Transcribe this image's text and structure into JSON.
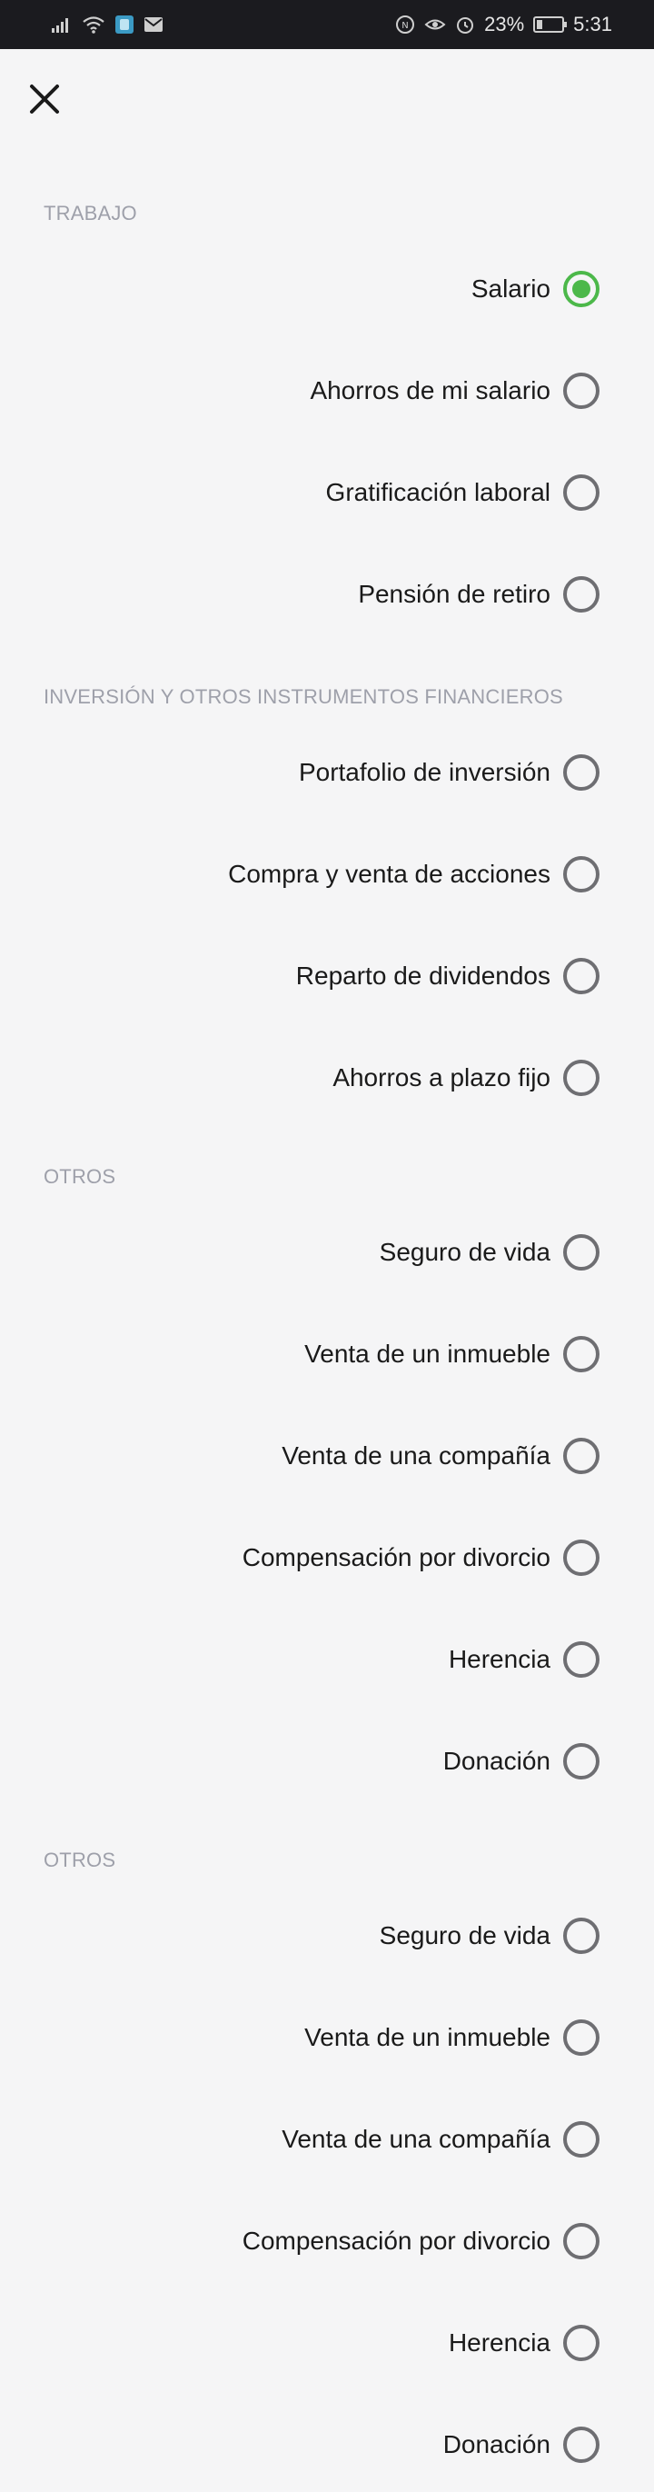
{
  "status_bar": {
    "battery_percent": "23%",
    "time": "5:31",
    "battery_level": 0.23
  },
  "close_icon": "close-icon",
  "sections": [
    {
      "title": "TRABAJO",
      "options": [
        {
          "label": "Salario",
          "selected": true
        },
        {
          "label": "Ahorros de mi salario",
          "selected": false
        },
        {
          "label": "Gratificación laboral",
          "selected": false
        },
        {
          "label": "Pensión de retiro",
          "selected": false
        }
      ]
    },
    {
      "title": "INVERSIÓN Y OTROS INSTRUMENTOS FINANCIEROS",
      "options": [
        {
          "label": "Portafolio de inversión",
          "selected": false
        },
        {
          "label": "Compra y venta de acciones",
          "selected": false
        },
        {
          "label": "Reparto de dividendos",
          "selected": false
        },
        {
          "label": "Ahorros a plazo fijo",
          "selected": false
        }
      ]
    },
    {
      "title": "OTROS",
      "options": [
        {
          "label": "Seguro de vida",
          "selected": false
        },
        {
          "label": "Venta de un inmueble",
          "selected": false
        },
        {
          "label": "Venta de una compañía",
          "selected": false
        },
        {
          "label": "Compensación por divorcio",
          "selected": false
        },
        {
          "label": "Herencia",
          "selected": false
        },
        {
          "label": "Donación",
          "selected": false
        }
      ]
    },
    {
      "title": "OTROS",
      "options": [
        {
          "label": "Seguro de vida",
          "selected": false
        },
        {
          "label": "Venta de un inmueble",
          "selected": false
        },
        {
          "label": "Venta de una compañía",
          "selected": false
        },
        {
          "label": "Compensación por divorcio",
          "selected": false
        },
        {
          "label": "Herencia",
          "selected": false
        },
        {
          "label": "Donación",
          "selected": false
        }
      ]
    }
  ],
  "colors": {
    "accent": "#4cb84a",
    "section_title": "#9ea0aa",
    "radio_border": "#6e6e72",
    "background": "#f5f5f6"
  }
}
